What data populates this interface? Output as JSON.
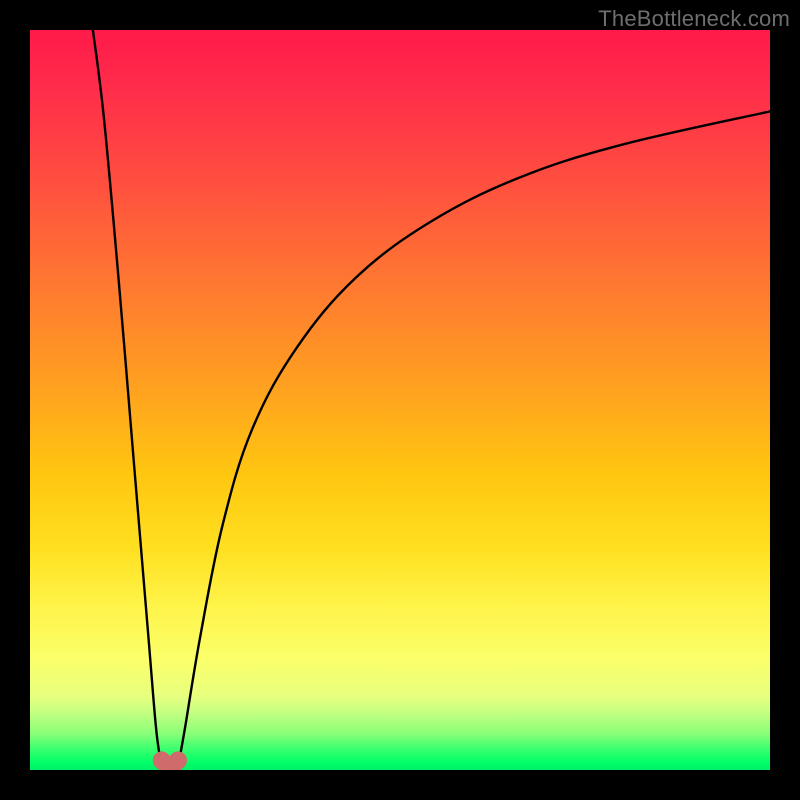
{
  "watermark": "TheBottleneck.com",
  "chart_data": {
    "type": "line",
    "title": "",
    "xlabel": "",
    "ylabel": "",
    "xlim": [
      0,
      100
    ],
    "ylim": [
      0,
      100
    ],
    "grid": false,
    "legend": false,
    "gradient_stops": [
      {
        "pct": 0,
        "color": "#ff1a4a"
      },
      {
        "pct": 8,
        "color": "#ff2d4a"
      },
      {
        "pct": 20,
        "color": "#ff4d40"
      },
      {
        "pct": 35,
        "color": "#ff7a30"
      },
      {
        "pct": 48,
        "color": "#ffa020"
      },
      {
        "pct": 60,
        "color": "#ffc610"
      },
      {
        "pct": 70,
        "color": "#ffe020"
      },
      {
        "pct": 78,
        "color": "#fff44a"
      },
      {
        "pct": 85,
        "color": "#fbff6a"
      },
      {
        "pct": 90,
        "color": "#e8ff7e"
      },
      {
        "pct": 92,
        "color": "#c8ff82"
      },
      {
        "pct": 95,
        "color": "#8cff78"
      },
      {
        "pct": 97,
        "color": "#40ff70"
      },
      {
        "pct": 99,
        "color": "#00ff68"
      },
      {
        "pct": 100,
        "color": "#00f068"
      }
    ],
    "series": [
      {
        "name": "left-branch",
        "color": "#000000",
        "x": [
          8.5,
          10,
          12,
          14,
          16,
          17,
          17.6
        ],
        "y": [
          100,
          88,
          66,
          42,
          18,
          6,
          1.5
        ]
      },
      {
        "name": "right-branch",
        "color": "#000000",
        "x": [
          20.2,
          21,
          23,
          26,
          30,
          36,
          44,
          54,
          66,
          80,
          100
        ],
        "y": [
          1.5,
          6,
          18,
          33,
          46,
          57,
          66.5,
          74,
          80,
          84.5,
          89
        ]
      }
    ],
    "markers": [
      {
        "name": "valley-node-left",
        "x": 17.8,
        "y": 1.3,
        "color": "#cf6b6b"
      },
      {
        "name": "valley-node-right",
        "x": 20.0,
        "y": 1.3,
        "color": "#cf6b6b"
      }
    ],
    "valley_connector": {
      "from_x": 17.8,
      "to_x": 20.0,
      "y_min": 0.1,
      "color": "#cf6b6b"
    }
  }
}
